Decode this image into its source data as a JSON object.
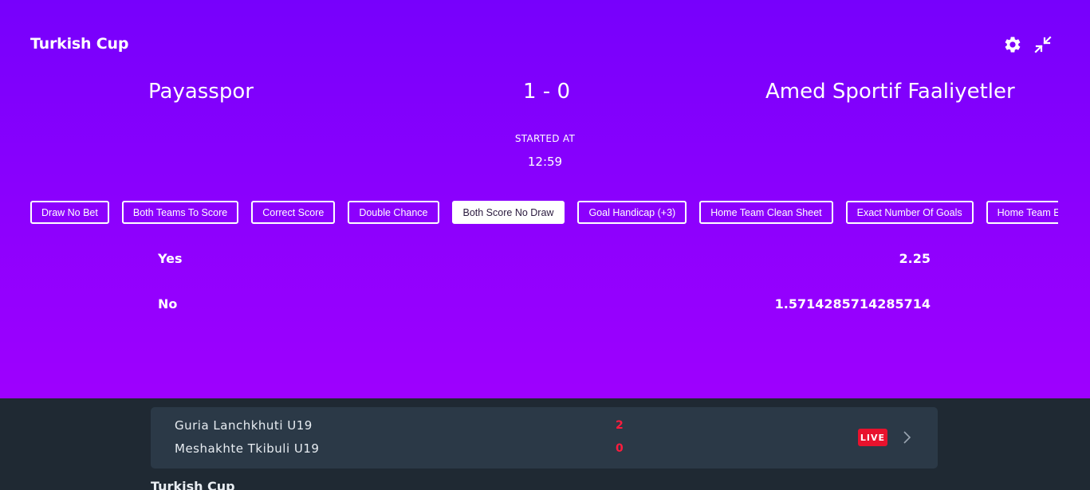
{
  "header": {
    "league": "Turkish Cup"
  },
  "match": {
    "home_team": "Payasspor",
    "away_team": "Amed Sportif Faaliyetler",
    "score": "1 - 0",
    "started_label": "STARTED AT",
    "started_time": "12:59"
  },
  "tabs": [
    {
      "label": "Draw No Bet",
      "active": false
    },
    {
      "label": "Both Teams To Score",
      "active": false
    },
    {
      "label": "Correct Score",
      "active": false
    },
    {
      "label": "Double Chance",
      "active": false
    },
    {
      "label": "Both Score No Draw",
      "active": true
    },
    {
      "label": "Goal Handicap (+3)",
      "active": false
    },
    {
      "label": "Home Team Clean Sheet",
      "active": false
    },
    {
      "label": "Exact Number Of Goals",
      "active": false
    },
    {
      "label": "Home Team Exact Goals",
      "active": false
    }
  ],
  "odds": [
    {
      "label": "Yes",
      "value": "2.25"
    },
    {
      "label": "No",
      "value": "1.5714285714285714"
    }
  ],
  "other_match": {
    "home_team": "Guria Lanchkhuti U19",
    "away_team": "Meshakhte Tkibuli U19",
    "home_score": "2",
    "away_score": "0",
    "live_label": "LIVE"
  },
  "next_section": {
    "title": "Turkish Cup"
  },
  "colors": {
    "accent": "#7700fc",
    "live": "#e8122d",
    "score_red": "#ff1c3d"
  }
}
